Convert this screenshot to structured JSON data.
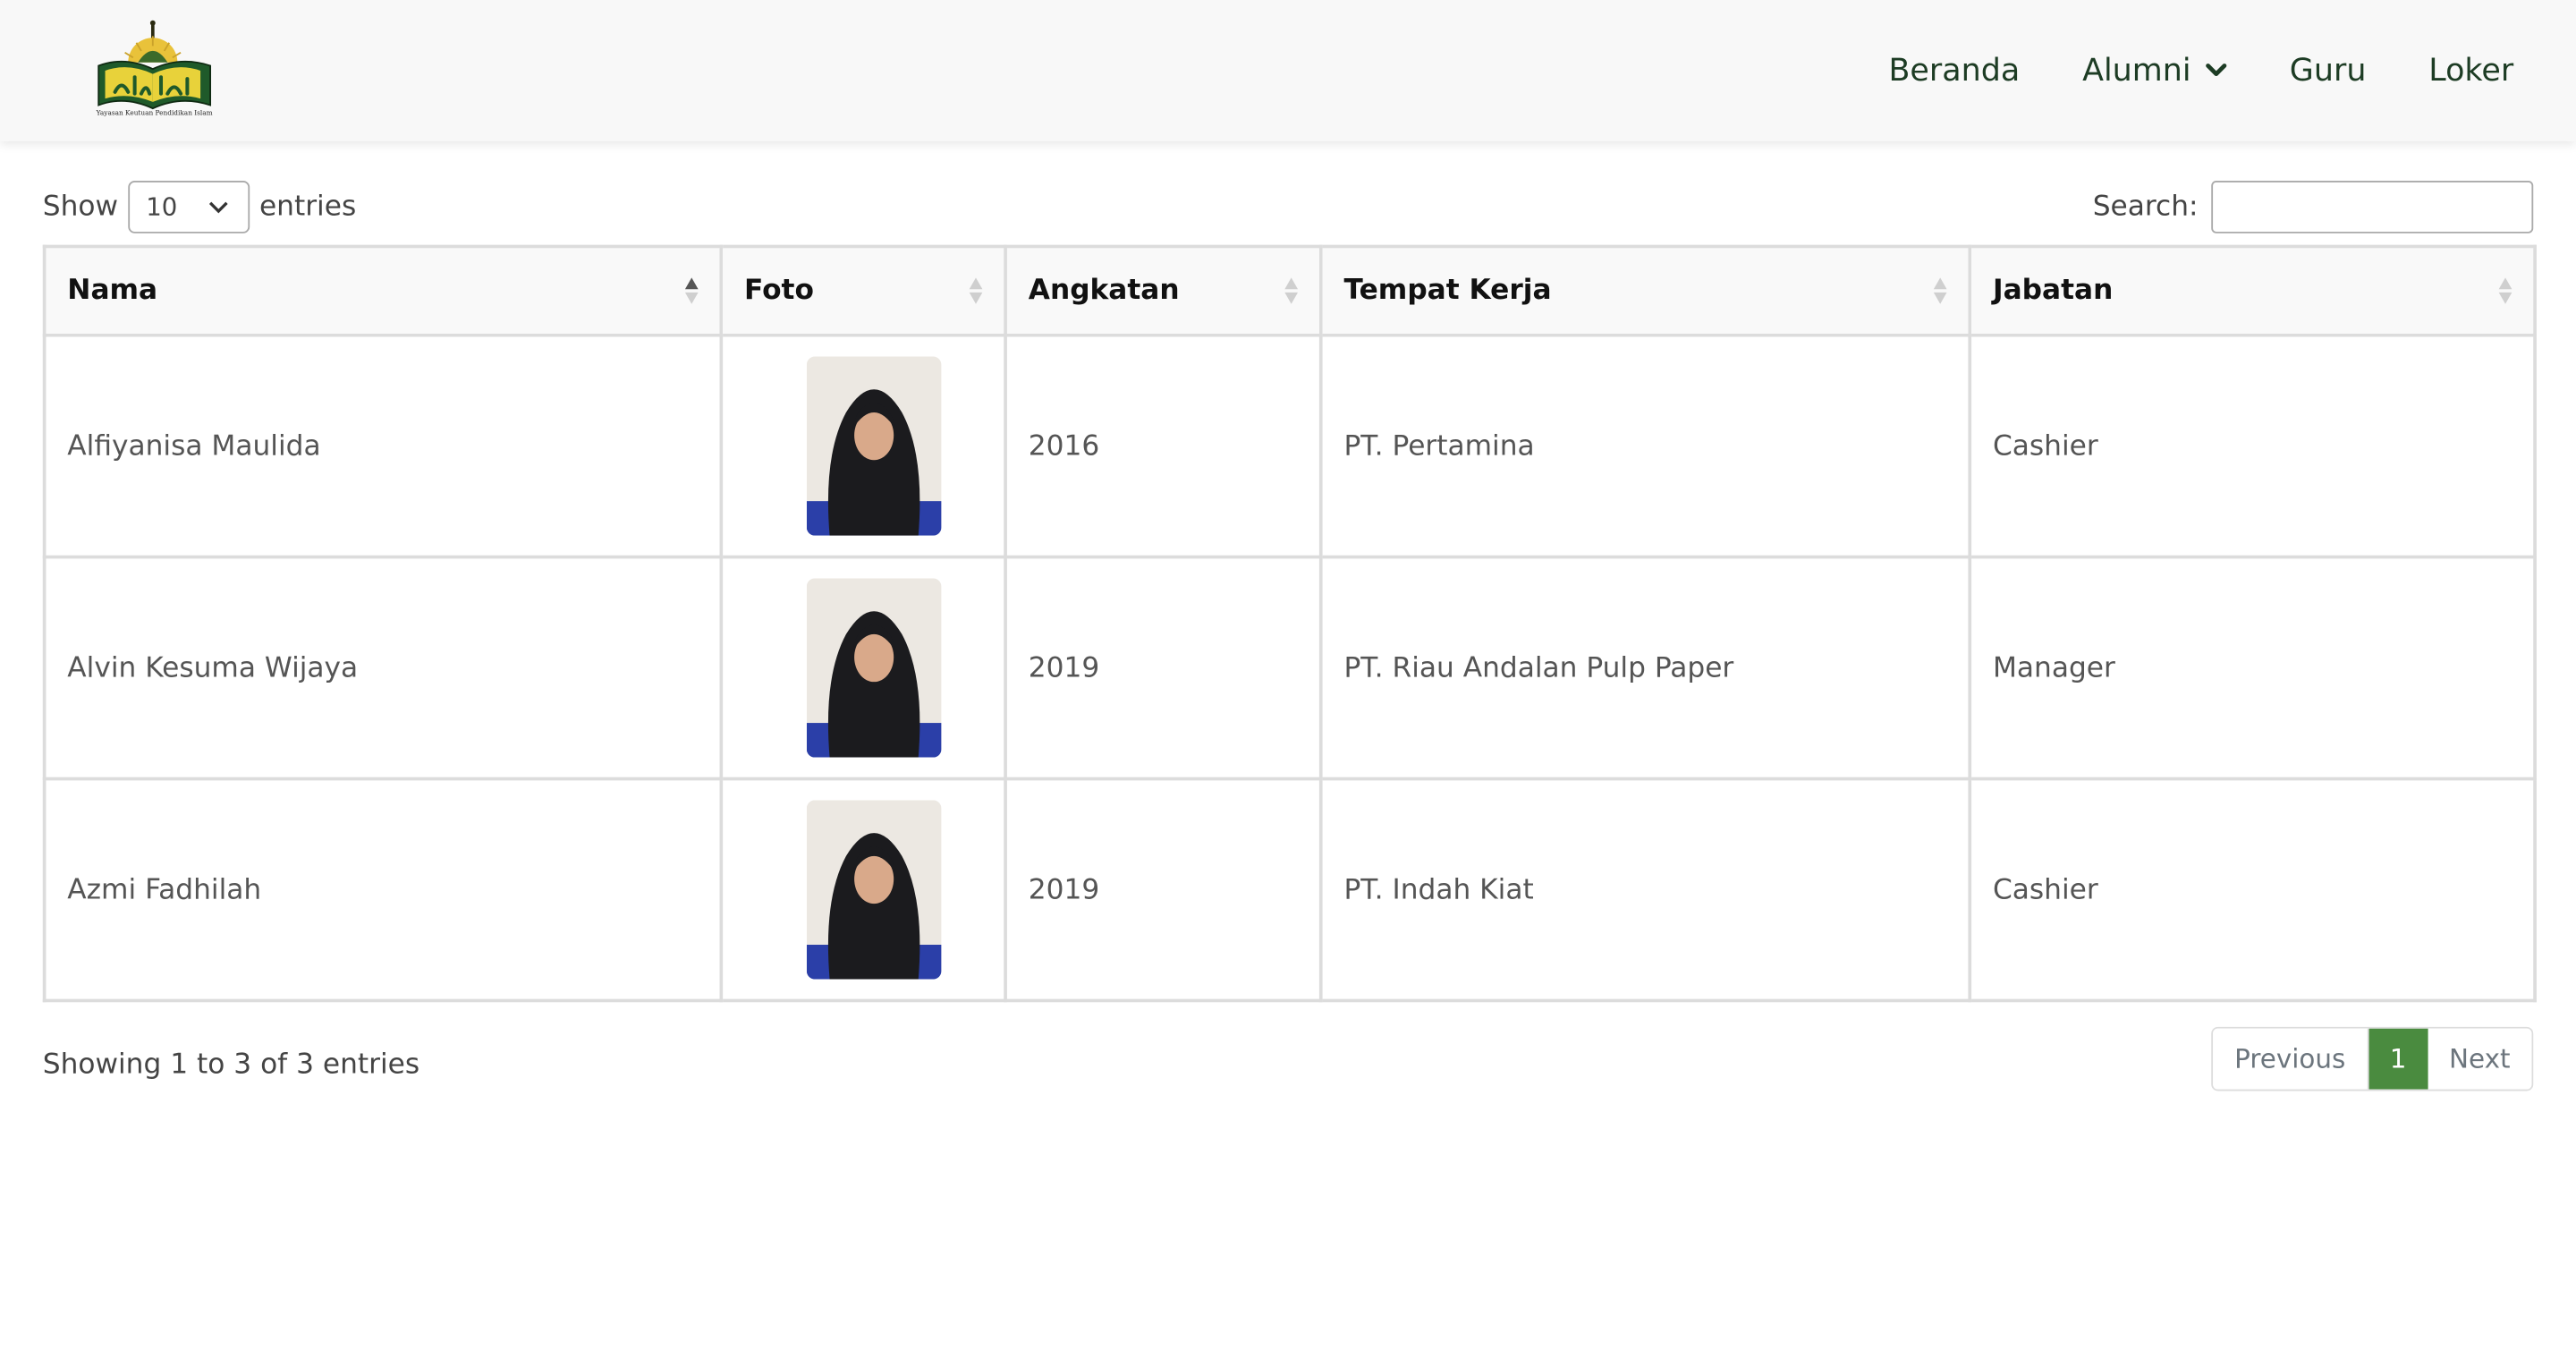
{
  "nav": {
    "logo_caption": "Yayasan Keutuan Pendidikan Islam",
    "items": [
      {
        "label": "Beranda"
      },
      {
        "label": "Alumni",
        "has_dropdown": true
      },
      {
        "label": "Guru"
      },
      {
        "label": "Loker"
      }
    ]
  },
  "controls": {
    "show_label": "Show",
    "entries_value": "10",
    "entries_label": "entries",
    "search_label": "Search:",
    "search_value": ""
  },
  "table": {
    "columns": [
      "Nama",
      "Foto",
      "Angkatan",
      "Tempat Kerja",
      "Jabatan"
    ],
    "sorted_column": "Nama",
    "rows": [
      {
        "nama": "Alfiyanisa Maulida",
        "angkatan": "2016",
        "tempat_kerja": "PT. Pertamina",
        "jabatan": "Cashier"
      },
      {
        "nama": "Alvin Kesuma Wijaya",
        "angkatan": "2019",
        "tempat_kerja": "PT. Riau Andalan Pulp Paper",
        "jabatan": "Manager"
      },
      {
        "nama": "Azmi Fadhilah",
        "angkatan": "2019",
        "tempat_kerja": "PT. Indah Kiat",
        "jabatan": "Cashier"
      }
    ]
  },
  "footer": {
    "info": "Showing 1 to 3 of 3 entries",
    "previous": "Previous",
    "current_page": "1",
    "next": "Next"
  },
  "colors": {
    "nav_text": "#1d3c24",
    "active_page": "#4a8b3f",
    "header_bg": "#f8f8f8"
  }
}
